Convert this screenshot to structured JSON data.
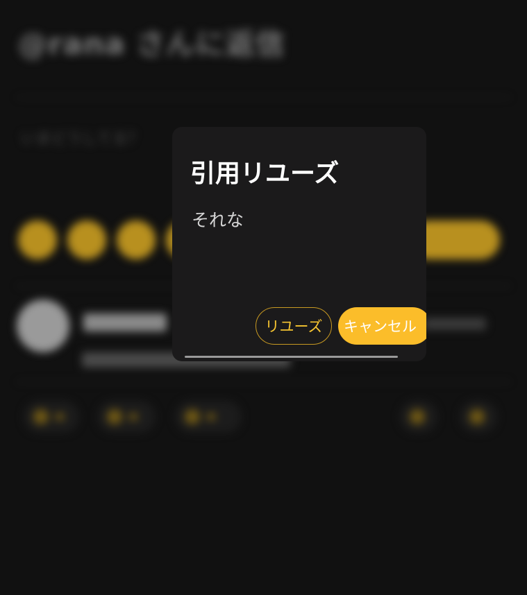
{
  "background": {
    "title": "@rana さんに返信",
    "compose_placeholder": "いまどうしてる？"
  },
  "dialog": {
    "title": "引用リユーズ",
    "text": "それな",
    "repost_label": "リユーズ",
    "cancel_label": "キャンセル"
  },
  "colors": {
    "accent": "#fbbd2a",
    "dialog_bg": "#1b1a1b",
    "page_bg": "#111111"
  }
}
